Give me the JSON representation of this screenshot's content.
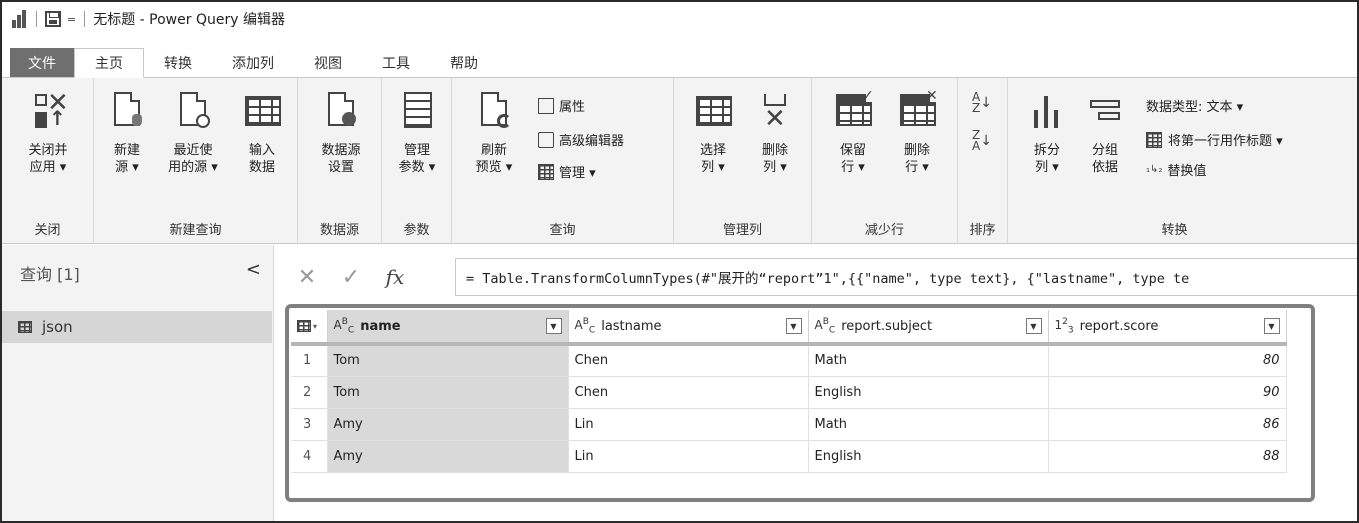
{
  "titlebar": {
    "title": "无标题 - Power Query 编辑器",
    "qat_dropdown": "="
  },
  "tabs": [
    {
      "label": "文件"
    },
    {
      "label": "主页"
    },
    {
      "label": "转换"
    },
    {
      "label": "添加列"
    },
    {
      "label": "视图"
    },
    {
      "label": "工具"
    },
    {
      "label": "帮助"
    }
  ],
  "ribbon": {
    "close": {
      "group": "关闭",
      "close_apply": "关闭并\n应用 ▾"
    },
    "new_query": {
      "group": "新建查询",
      "new_source": "新建\n源 ▾",
      "recent_sources": "最近使\n用的源 ▾",
      "enter_data": "输入\n数据"
    },
    "datasource": {
      "group": "数据源",
      "settings": "数据源\n设置"
    },
    "params": {
      "group": "参数",
      "manage": "管理\n参数 ▾"
    },
    "query": {
      "group": "查询",
      "refresh": "刷新\n预览 ▾",
      "properties": "属性",
      "advanced_editor": "高级编辑器",
      "manage": "管理 ▾"
    },
    "manage_cols": {
      "group": "管理列",
      "choose": "选择\n列 ▾",
      "remove": "删除\n列 ▾"
    },
    "reduce_rows": {
      "group": "减少行",
      "keep": "保留\n行 ▾",
      "remove": "删除\n行 ▾"
    },
    "sort": {
      "group": "排序"
    },
    "transform": {
      "group": "转换",
      "split": "拆分\n列 ▾",
      "group_by": "分组\n依据",
      "data_type": "数据类型: 文本 ▾",
      "first_row_header": "将第一行用作标题 ▾",
      "replace_values": "替换值"
    }
  },
  "queries_panel": {
    "title": "查询 [1]",
    "collapse": "<",
    "items": [
      {
        "label": "json"
      }
    ]
  },
  "formula_bar": {
    "cancel": "✕",
    "commit": "✓",
    "fx": "fx",
    "formula": "= Table.TransformColumnTypes(#\"展开的“report”1\",{{\"name\", type text}, {\"lastname\", type te"
  },
  "grid": {
    "columns": [
      {
        "type": "ABC",
        "name": "name"
      },
      {
        "type": "ABC",
        "name": "lastname"
      },
      {
        "type": "ABC",
        "name": "report.subject"
      },
      {
        "type": "123",
        "name": "report.score"
      }
    ],
    "rows": [
      {
        "idx": "1",
        "name": "Tom",
        "lastname": "Chen",
        "subject": "Math",
        "score": "80"
      },
      {
        "idx": "2",
        "name": "Tom",
        "lastname": "Chen",
        "subject": "English",
        "score": "90"
      },
      {
        "idx": "3",
        "name": "Amy",
        "lastname": "Lin",
        "subject": "Math",
        "score": "86"
      },
      {
        "idx": "4",
        "name": "Amy",
        "lastname": "Lin",
        "subject": "English",
        "score": "88"
      }
    ]
  }
}
